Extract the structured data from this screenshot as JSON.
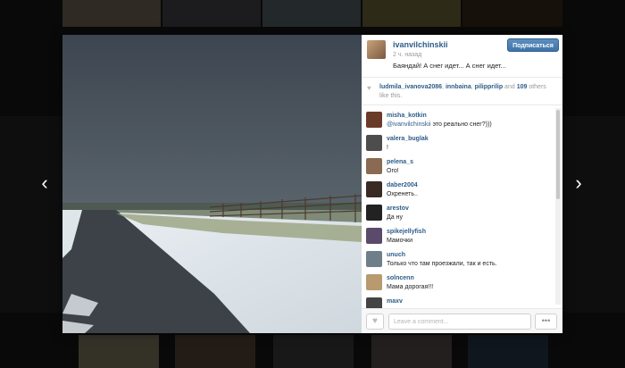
{
  "navigation": {
    "prev_icon": "chevron-left-icon",
    "next_icon": "chevron-right-icon",
    "prev_glyph": "‹",
    "next_glyph": "›"
  },
  "post": {
    "username": "ivanvilchinskii",
    "time_ago": "2 ч. назад",
    "caption": "Баяндай! А снег идет... А снег идет...",
    "follow_label": "Подписаться"
  },
  "likes": {
    "users": [
      "ludmila_ivanova2086",
      "innbaina",
      "pilipprilip"
    ],
    "separator1": ", ",
    "separator2": ", ",
    "and_text": " and ",
    "count": "109",
    "suffix": " others like this."
  },
  "comments": [
    {
      "user": "misha_kotkin",
      "mention": "@ivanvilchinskii",
      "text": " это реально снег?)))"
    },
    {
      "user": "valera_buglak",
      "mention": "",
      "text": "!"
    },
    {
      "user": "pelena_s",
      "mention": "",
      "text": "Ого!"
    },
    {
      "user": "daber2004",
      "mention": "",
      "text": "Охренеть.."
    },
    {
      "user": "arestov",
      "mention": "",
      "text": "Да ну"
    },
    {
      "user": "spikejellyfish",
      "mention": "",
      "text": "Мамочки"
    },
    {
      "user": "unuch",
      "mention": "",
      "text": "Только что там проезжали, так и есть."
    },
    {
      "user": "solncenn",
      "mention": "",
      "text": "Мама дорогая!!!"
    },
    {
      "user": "maxv",
      "mention": "",
      "text": ""
    }
  ],
  "footer": {
    "comment_placeholder": "Leave a comment...",
    "like_icon": "heart-icon",
    "more_label": "•••"
  },
  "colors": {
    "link": "#2d5c88",
    "follow_button": "#3f74a8"
  }
}
